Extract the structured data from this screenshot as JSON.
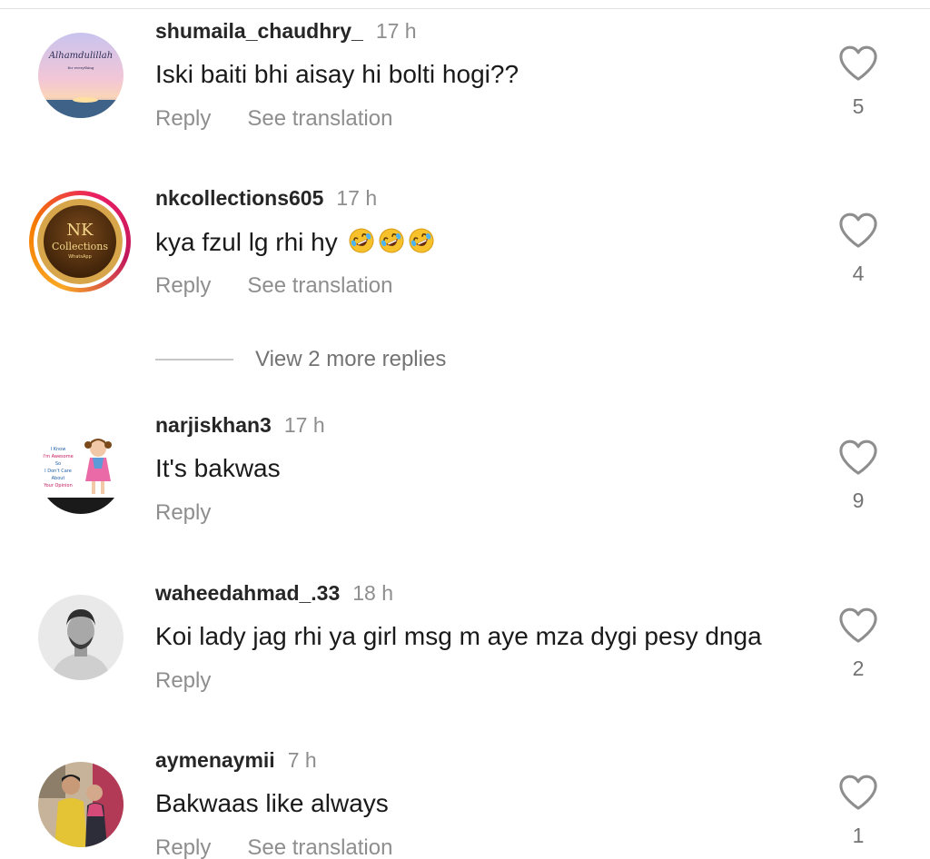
{
  "comments": [
    {
      "username": "shumaila_chaudhry_",
      "time": "17 h",
      "text": "Iski baiti bhi aisay hi bolti hogi??",
      "reply_label": "Reply",
      "translation_label": "See translation",
      "likes": "5",
      "avatar_text": "Alhamdulillah",
      "avatar_subtext": "for everything"
    },
    {
      "username": "nkcollections605",
      "time": "17 h",
      "text": "kya fzul lg rhi hy",
      "emojis": [
        "rolling-on-floor-laughing-emoji",
        "rolling-on-floor-laughing-emoji",
        "rolling-on-floor-laughing-emoji"
      ],
      "reply_label": "Reply",
      "translation_label": "See translation",
      "likes": "4",
      "avatar_text": "NK",
      "avatar_subtext": "Collections",
      "avatar_small": "WhatsApp"
    },
    {
      "username": "narjiskhan3",
      "time": "17 h",
      "text": "It's bakwas",
      "reply_label": "Reply",
      "likes": "9",
      "avatar_lines": [
        "I Know",
        "I'm Awesome",
        "So",
        "I Don't Care",
        "About",
        "Your Opinion"
      ]
    },
    {
      "username": "waheedahmad_.33",
      "time": "18 h",
      "text": "Koi lady jag rhi ya girl msg m aye mza dygi pesy dnga",
      "reply_label": "Reply",
      "likes": "2"
    },
    {
      "username": "aymenaymii",
      "time": "7 h",
      "text": "Bakwaas like always",
      "reply_label": "Reply",
      "translation_label": "See translation",
      "likes": "1"
    }
  ],
  "view_more": {
    "label": "View 2 more replies"
  },
  "colors": {
    "text": "#262626",
    "secondary": "#8e8e8e",
    "divider": "#e2e2e2"
  }
}
